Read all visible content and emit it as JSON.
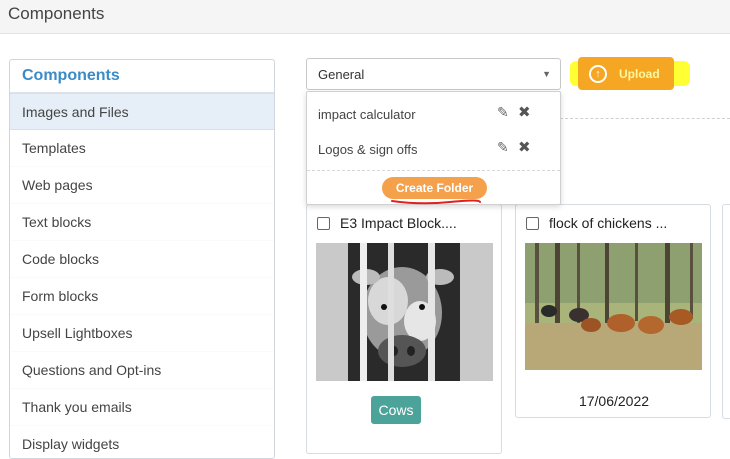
{
  "header": {
    "title": "Components"
  },
  "sidebar": {
    "title": "Components",
    "items": [
      {
        "label": "Images and Files",
        "active": true
      },
      {
        "label": "Templates"
      },
      {
        "label": "Web pages"
      },
      {
        "label": "Text blocks"
      },
      {
        "label": "Code blocks"
      },
      {
        "label": "Form blocks"
      },
      {
        "label": "Upsell Lightboxes"
      },
      {
        "label": "Questions and Opt-ins"
      },
      {
        "label": "Thank you emails"
      },
      {
        "label": "Display widgets"
      }
    ]
  },
  "folder_select": {
    "value": "General"
  },
  "upload": {
    "label": "Upload",
    "icon": "upload-arrow-icon"
  },
  "folder_dropdown": {
    "folders": [
      {
        "name": "impact calculator"
      },
      {
        "name": "Logos & sign offs"
      }
    ],
    "create_label": "Create Folder"
  },
  "cards": [
    {
      "title": "E3 Impact Block....",
      "tag": "Cows"
    },
    {
      "title": "flock of chickens ...",
      "date": "17/06/2022"
    }
  ],
  "colors": {
    "accent": "#3a8bc8",
    "upload_orange": "#f5a623",
    "highlight_yellow": "#ffff33",
    "tag_teal": "#4ca39a"
  }
}
